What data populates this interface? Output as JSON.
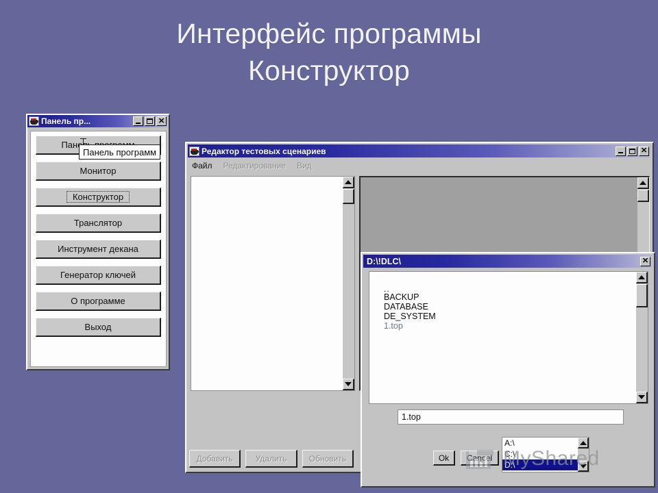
{
  "slide": {
    "title_line1": "Интерфейс программы",
    "title_line2": "Конструктор",
    "background_color": "#656699",
    "title_color": "#f2f2f5"
  },
  "panel_window": {
    "title": "Панель пр...",
    "icon": "java-cup-icon",
    "controls": {
      "minimize": "_",
      "maximize": "□",
      "close": "✕"
    },
    "tooltip": "Панель программ",
    "buttons": [
      {
        "label": "Панель программ",
        "state": "covered-by-tooltip"
      },
      {
        "label": "Монитор",
        "state": "normal"
      },
      {
        "label": "Конструктор",
        "state": "focused"
      },
      {
        "label": "Транслятор",
        "state": "normal"
      },
      {
        "label": "Инструмент декана",
        "state": "normal"
      },
      {
        "label": "Генератор ключей",
        "state": "normal"
      },
      {
        "label": "О программе",
        "state": "normal"
      },
      {
        "label": "Выход",
        "state": "normal"
      }
    ]
  },
  "editor_window": {
    "title": "Редактор тестовых сценариев",
    "icon": "java-cup-icon",
    "controls": {
      "minimize": "_",
      "maximize": "□",
      "close": "✕"
    },
    "menu": [
      {
        "label": "Файл",
        "enabled": true
      },
      {
        "label": "Редактирование",
        "enabled": false
      },
      {
        "label": "Вид",
        "enabled": false
      }
    ],
    "left_list_items": [],
    "right_pane_content": "",
    "action_buttons": [
      {
        "label": "Добавить",
        "enabled": false
      },
      {
        "label": "Удалить",
        "enabled": false
      },
      {
        "label": "Обновить",
        "enabled": false
      }
    ]
  },
  "file_dialog": {
    "title": "D:\\!DLC\\",
    "close_label": "✕",
    "file_list": [
      {
        "name": "..",
        "kind": "parent"
      },
      {
        "name": "BACKUP",
        "kind": "folder"
      },
      {
        "name": "DATABASE",
        "kind": "folder"
      },
      {
        "name": "DE_SYSTEM",
        "kind": "folder"
      },
      {
        "name": "1.top",
        "kind": "file",
        "selected": true
      }
    ],
    "filename_value": "1.top",
    "ok_label": "Ok",
    "cancel_label": "Cancel",
    "drives": [
      {
        "label": "A:\\",
        "selected": false
      },
      {
        "label": "C:\\",
        "selected": false
      },
      {
        "label": "D:\\",
        "selected": true
      }
    ]
  },
  "watermark": {
    "text": "MyShared",
    "icon": "bar-chart-icon"
  }
}
